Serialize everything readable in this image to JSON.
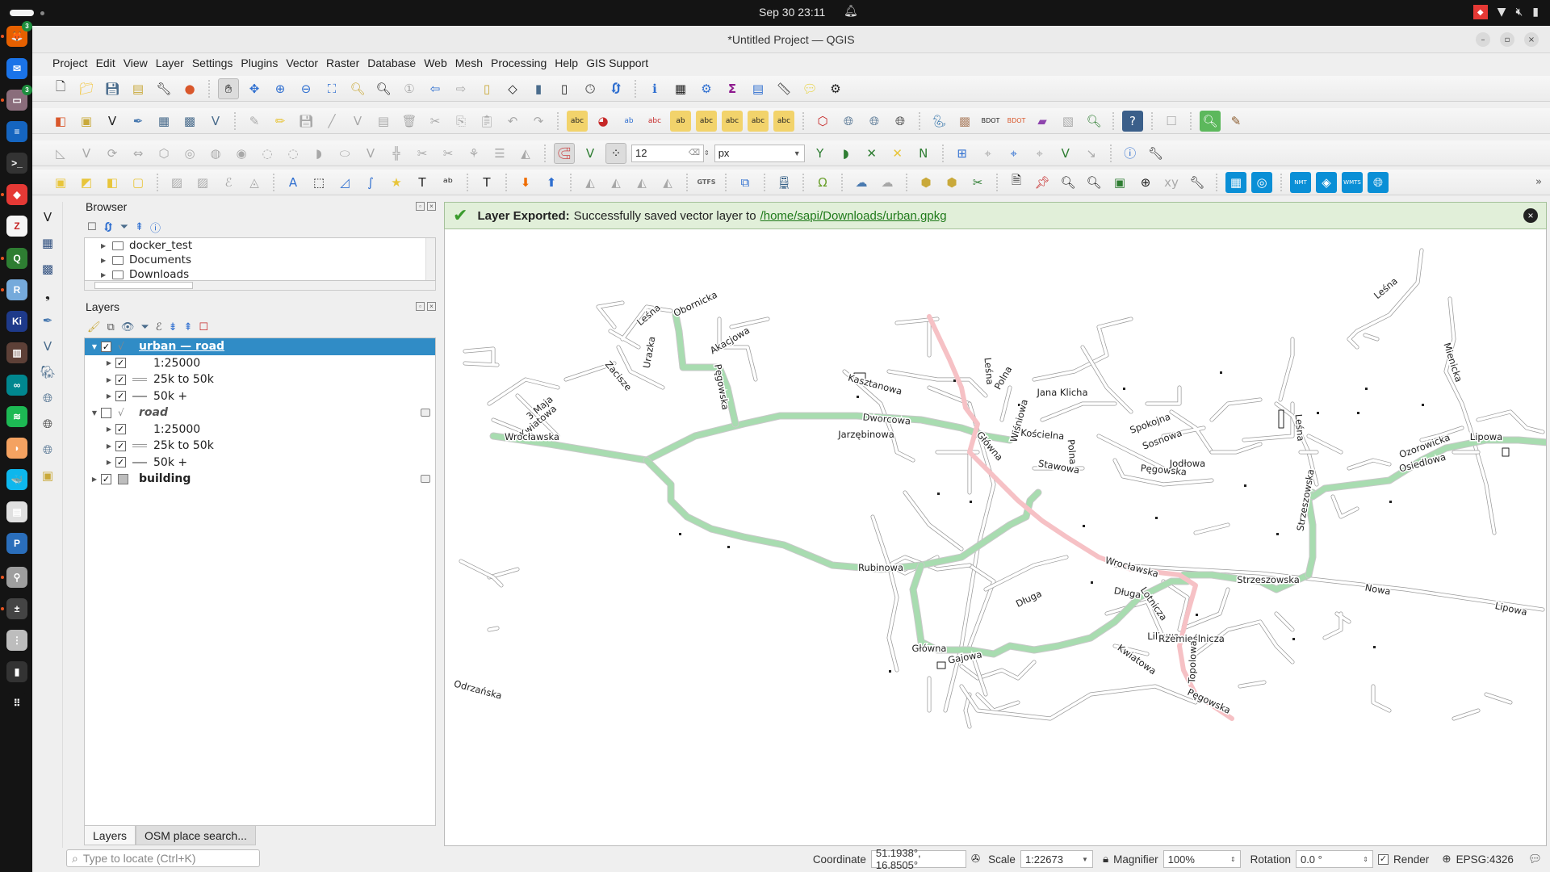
{
  "system_bar": {
    "clock": "Sep 30  23:11",
    "tray_icons": [
      "anydesk-icon",
      "wifi-icon",
      "volume-muted-icon",
      "battery-icon"
    ]
  },
  "dock": {
    "apps": [
      {
        "name": "firefox",
        "color": "#e66000",
        "glyph": "🦊",
        "badge": "3",
        "running": true
      },
      {
        "name": "thunderbird",
        "color": "#1a73e8",
        "glyph": "✉",
        "badge": "",
        "running": false
      },
      {
        "name": "files",
        "color": "#8a6d7b",
        "glyph": "▭",
        "badge": "3",
        "running": true
      },
      {
        "name": "libreoffice-writer",
        "color": "#1565c0",
        "glyph": "≡",
        "badge": "",
        "running": false
      },
      {
        "name": "terminal",
        "color": "#333333",
        "glyph": ">_",
        "badge": "",
        "running": false
      },
      {
        "name": "anydesk",
        "color": "#e53935",
        "glyph": "◆",
        "badge": "",
        "running": true
      },
      {
        "name": "zotero",
        "color": "#f5f5f5",
        "glyph": "Z",
        "badge": "",
        "running": false
      },
      {
        "name": "qgis",
        "color": "#2e7d32",
        "glyph": "Q",
        "badge": "",
        "running": true
      },
      {
        "name": "rstudio",
        "color": "#75aadb",
        "glyph": "R",
        "badge": "",
        "running": true
      },
      {
        "name": "kicad",
        "color": "#1e3a8a",
        "glyph": "Ki",
        "badge": "",
        "running": false
      },
      {
        "name": "calibre",
        "color": "#5d4037",
        "glyph": "▥",
        "badge": "",
        "running": false
      },
      {
        "name": "arduino",
        "color": "#00878f",
        "glyph": "∞",
        "badge": "",
        "running": false
      },
      {
        "name": "spotify",
        "color": "#1db954",
        "glyph": "≋",
        "badge": "",
        "running": false
      },
      {
        "name": "clementine",
        "color": "#f4a261",
        "glyph": "◗",
        "badge": "",
        "running": false
      },
      {
        "name": "docker",
        "color": "#0db7ed",
        "glyph": "🐳",
        "badge": "",
        "running": false
      },
      {
        "name": "document-viewer",
        "color": "#e0e0e0",
        "glyph": "▤",
        "badge": "",
        "running": false
      },
      {
        "name": "pritunl",
        "color": "#2a6ebb",
        "glyph": "P",
        "badge": "",
        "running": false
      },
      {
        "name": "usb-drive",
        "color": "#9e9e9e",
        "glyph": "⚲",
        "badge": "",
        "running": true
      },
      {
        "name": "calculator",
        "color": "#444444",
        "glyph": "±",
        "badge": "",
        "running": true
      },
      {
        "name": "disks",
        "color": "#bdbdbd",
        "glyph": "⋮",
        "badge": "",
        "running": false
      },
      {
        "name": "trash",
        "color": "#333333",
        "glyph": "▮",
        "badge": "",
        "running": false
      },
      {
        "name": "show-apps",
        "color": "#141414",
        "glyph": "⠿",
        "badge": "",
        "running": false
      }
    ]
  },
  "window": {
    "title": "*Untitled Project — QGIS",
    "buttons": {
      "minimize": "–",
      "maximize": "▫",
      "close": "×"
    }
  },
  "menu": [
    "Project",
    "Edit",
    "View",
    "Layer",
    "Settings",
    "Plugins",
    "Vector",
    "Raster",
    "Database",
    "Web",
    "Mesh",
    "Processing",
    "Help",
    "GIS Support"
  ],
  "toolbar_snapping": {
    "tolerance_value": "12",
    "units_value": "px"
  },
  "browser_panel": {
    "title": "Browser",
    "items": [
      {
        "label": "docker_test"
      },
      {
        "label": "Documents"
      },
      {
        "label": "Downloads"
      }
    ]
  },
  "layers_panel": {
    "title": "Layers",
    "layers": [
      {
        "label": "urban — road",
        "checked": true,
        "expanded": true,
        "selected": true,
        "style": "link",
        "indent": 0,
        "symbol": "line-vertex"
      },
      {
        "label": "1:25000",
        "checked": true,
        "expanded": false,
        "selected": false,
        "style": "normal",
        "indent": 1,
        "symbol": "none"
      },
      {
        "label": "25k to 50k",
        "checked": true,
        "expanded": false,
        "selected": false,
        "style": "normal",
        "indent": 1,
        "symbol": "double-line"
      },
      {
        "label": "50k +",
        "checked": true,
        "expanded": false,
        "selected": false,
        "style": "normal",
        "indent": 1,
        "symbol": "line"
      },
      {
        "label": "road",
        "checked": false,
        "expanded": true,
        "selected": false,
        "style": "italic",
        "indent": 0,
        "symbol": "line-vertex"
      },
      {
        "label": "1:25000",
        "checked": true,
        "expanded": false,
        "selected": false,
        "style": "normal",
        "indent": 1,
        "symbol": "none"
      },
      {
        "label": "25k to 50k",
        "checked": true,
        "expanded": false,
        "selected": false,
        "style": "normal",
        "indent": 1,
        "symbol": "double-line"
      },
      {
        "label": "50k +",
        "checked": true,
        "expanded": false,
        "selected": false,
        "style": "normal",
        "indent": 1,
        "symbol": "line"
      },
      {
        "label": "building",
        "checked": true,
        "expanded": false,
        "selected": false,
        "style": "bold",
        "indent": 0,
        "symbol": "polygon"
      }
    ]
  },
  "panel_tabs": [
    "Layers",
    "OSM place search..."
  ],
  "locator": {
    "placeholder": "Type to locate (Ctrl+K)"
  },
  "message_bar": {
    "title": "Layer Exported:",
    "text": "Successfully saved vector layer to",
    "link": "/home/sapi/Downloads/urban.gpkg",
    "level": "success"
  },
  "map": {
    "colors": {
      "primary_road": "#a8dcb0",
      "main_road": "#f6c1c5",
      "minor_road_casing": "#9a9a9a",
      "background": "#ffffff"
    },
    "street_labels": [
      "Leśna",
      "Obornicka",
      "Akacjowa",
      "Urazka",
      "Zacisze",
      "3 Maja",
      "Kwiatowa",
      "Wrocławska",
      "Pęgowska",
      "Kasztanowa",
      "Dworcowa",
      "Jarzębinowa",
      "Leśna",
      "Polna",
      "Jana Klicha",
      "Wiśniowa",
      "Kościelna",
      "Główna",
      "Stawowa",
      "Spokojna",
      "Sosnowa",
      "Polna",
      "Pęgowska",
      "Jodłowa",
      "Leśna",
      "Leśna",
      "Mienicka",
      "Ozorowicka",
      "Osiedlowa",
      "Lipowa",
      "Strzeszowska",
      "Wrocławska",
      "Rubinowa",
      "Strzeszowska",
      "Długa",
      "Długa",
      "Lotnicza",
      "Nowa",
      "Lipowa",
      "Liliowa",
      "Rzemieślnicza",
      "Topolowa",
      "Kwiatowa",
      "Główna",
      "Gajowa",
      "Pęgowska",
      "Odrzańska"
    ]
  },
  "status_bar": {
    "coordinate_label": "Coordinate",
    "coordinate_value": "51.1938°, 16.8505°",
    "scale_label": "Scale",
    "scale_value": "1:22673",
    "magnifier_label": "Magnifier",
    "magnifier_value": "100%",
    "rotation_label": "Rotation",
    "rotation_value": "0.0 °",
    "render_label": "Render",
    "render_checked": true,
    "crs": "EPSG:4326"
  }
}
